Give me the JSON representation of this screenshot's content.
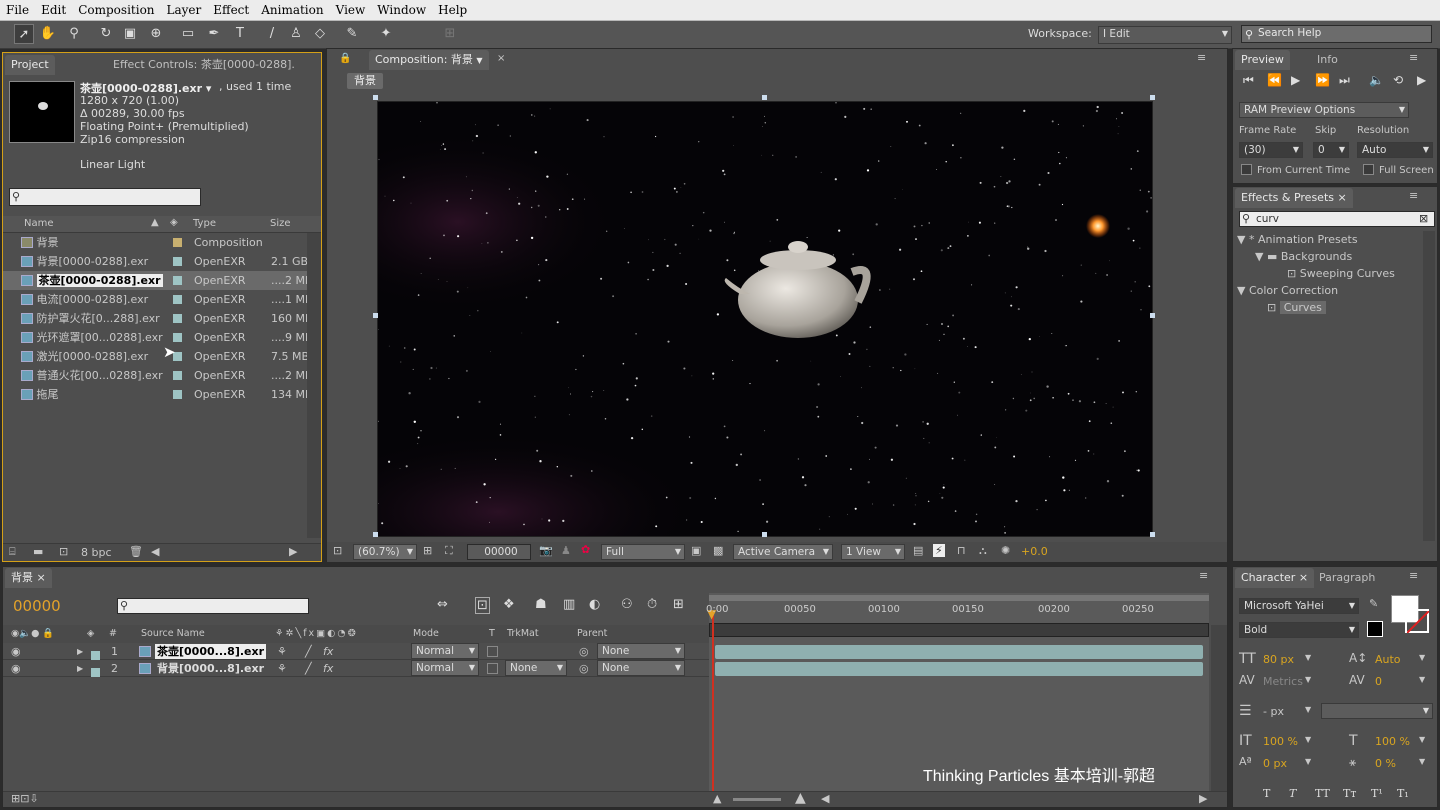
{
  "menu": [
    "File",
    "Edit",
    "Composition",
    "Layer",
    "Effect",
    "Animation",
    "View",
    "Window",
    "Help"
  ],
  "toolbar": {
    "workspace_label": "Workspace:",
    "workspace_value": "I Edit",
    "search_placeholder": "Search Help"
  },
  "project": {
    "tab_project": "Project",
    "tab_effect_controls": "Effect Controls: 茶壶[0000-0288].",
    "file_name": "茶壶[0000-0288].exr ▾",
    "used": ", used 1 time",
    "info_lines": [
      "1280 x 720 (1.00)",
      "Δ 00289, 30.00 fps",
      "Floating Point+ (Premultiplied)",
      "Zip16 compression"
    ],
    "color_space": "Linear Light",
    "columns": {
      "name": "Name",
      "type": "Type",
      "size": "Size"
    },
    "items": [
      {
        "name": "背景",
        "type": "Composition",
        "size": ""
      },
      {
        "name": "背景[0000-0288].exr",
        "type": "OpenEXR",
        "size": "2.1 GB"
      },
      {
        "name": "茶壶[0000-0288].exr",
        "type": "OpenEXR",
        "size": "....2 MB"
      },
      {
        "name": "电流[0000-0288].exr",
        "type": "OpenEXR",
        "size": "....1 MB"
      },
      {
        "name": "防护罩火花[0...288].exr",
        "type": "OpenEXR",
        "size": "160 MB"
      },
      {
        "name": "光环遮罩[00...0288].exr",
        "type": "OpenEXR",
        "size": "....9 MB"
      },
      {
        "name": "激光[0000-0288].exr",
        "type": "OpenEXR",
        "size": "7.5 MB"
      },
      {
        "name": "普通火花[00...0288].exr",
        "type": "OpenEXR",
        "size": "....2 MB"
      },
      {
        "name": "拖尾",
        "type": "OpenEXR",
        "size": "134 MB"
      }
    ],
    "bpc": "8 bpc"
  },
  "composition": {
    "tab": "Composition: 背景",
    "breadcrumb": "背景",
    "zoom": "(60.7%)",
    "timecode": "00000",
    "resolution": "Full",
    "camera": "Active Camera",
    "views": "1 View",
    "exposure": "+0.0"
  },
  "preview": {
    "tab_preview": "Preview",
    "tab_info": "Info",
    "ram_options": "RAM Preview Options",
    "frame_rate_label": "Frame Rate",
    "skip_label": "Skip",
    "resolution_label": "Resolution",
    "frame_rate": "(30)",
    "skip": "0",
    "resolution": "Auto",
    "from_current": "From Current Time",
    "full_screen": "Full Screen"
  },
  "effects": {
    "tab": "Effects & Presets",
    "search": "curv",
    "tree": [
      {
        "label": "* Animation Presets",
        "level": 0
      },
      {
        "label": "Backgrounds",
        "level": 1
      },
      {
        "label": "Sweeping Curves",
        "level": 2
      },
      {
        "label": "Color Correction",
        "level": 0
      },
      {
        "label": "Curves",
        "level": 1
      }
    ]
  },
  "timeline": {
    "tab": "背景",
    "timecode": "00000",
    "ticks": [
      "0:00",
      "00050",
      "00100",
      "00150",
      "00200",
      "00250"
    ],
    "columns": {
      "num": "#",
      "source": "Source Name",
      "mode": "Mode",
      "t": "T",
      "trkmat": "TrkMat",
      "parent": "Parent"
    },
    "layers": [
      {
        "num": "1",
        "name": "茶壶[0000...8].exr",
        "mode": "Normal",
        "trkmat": "",
        "parent": "None"
      },
      {
        "num": "2",
        "name": "背景[0000...8].exr",
        "mode": "Normal",
        "trkmat": "None",
        "parent": "None"
      }
    ],
    "watermark": "Thinking Particles 基本培训-郭超"
  },
  "character": {
    "tab_character": "Character",
    "tab_paragraph": "Paragraph",
    "font": "Microsoft YaHei",
    "style": "Bold",
    "size": "80 px",
    "leading": "Auto",
    "kerning": "Metrics",
    "tracking": "0",
    "stroke": "- px",
    "vscale": "100 %",
    "hscale": "100 %",
    "baseline": "0 px",
    "tsume": "0 %",
    "styles": [
      "T",
      "T",
      "TT",
      "Tт",
      "T¹",
      "T₁"
    ]
  },
  "colors": {
    "accent": "#e3a22a",
    "panel": "#4e4e4e",
    "bar": "#8fb0b0",
    "playhead": "#d03020"
  }
}
